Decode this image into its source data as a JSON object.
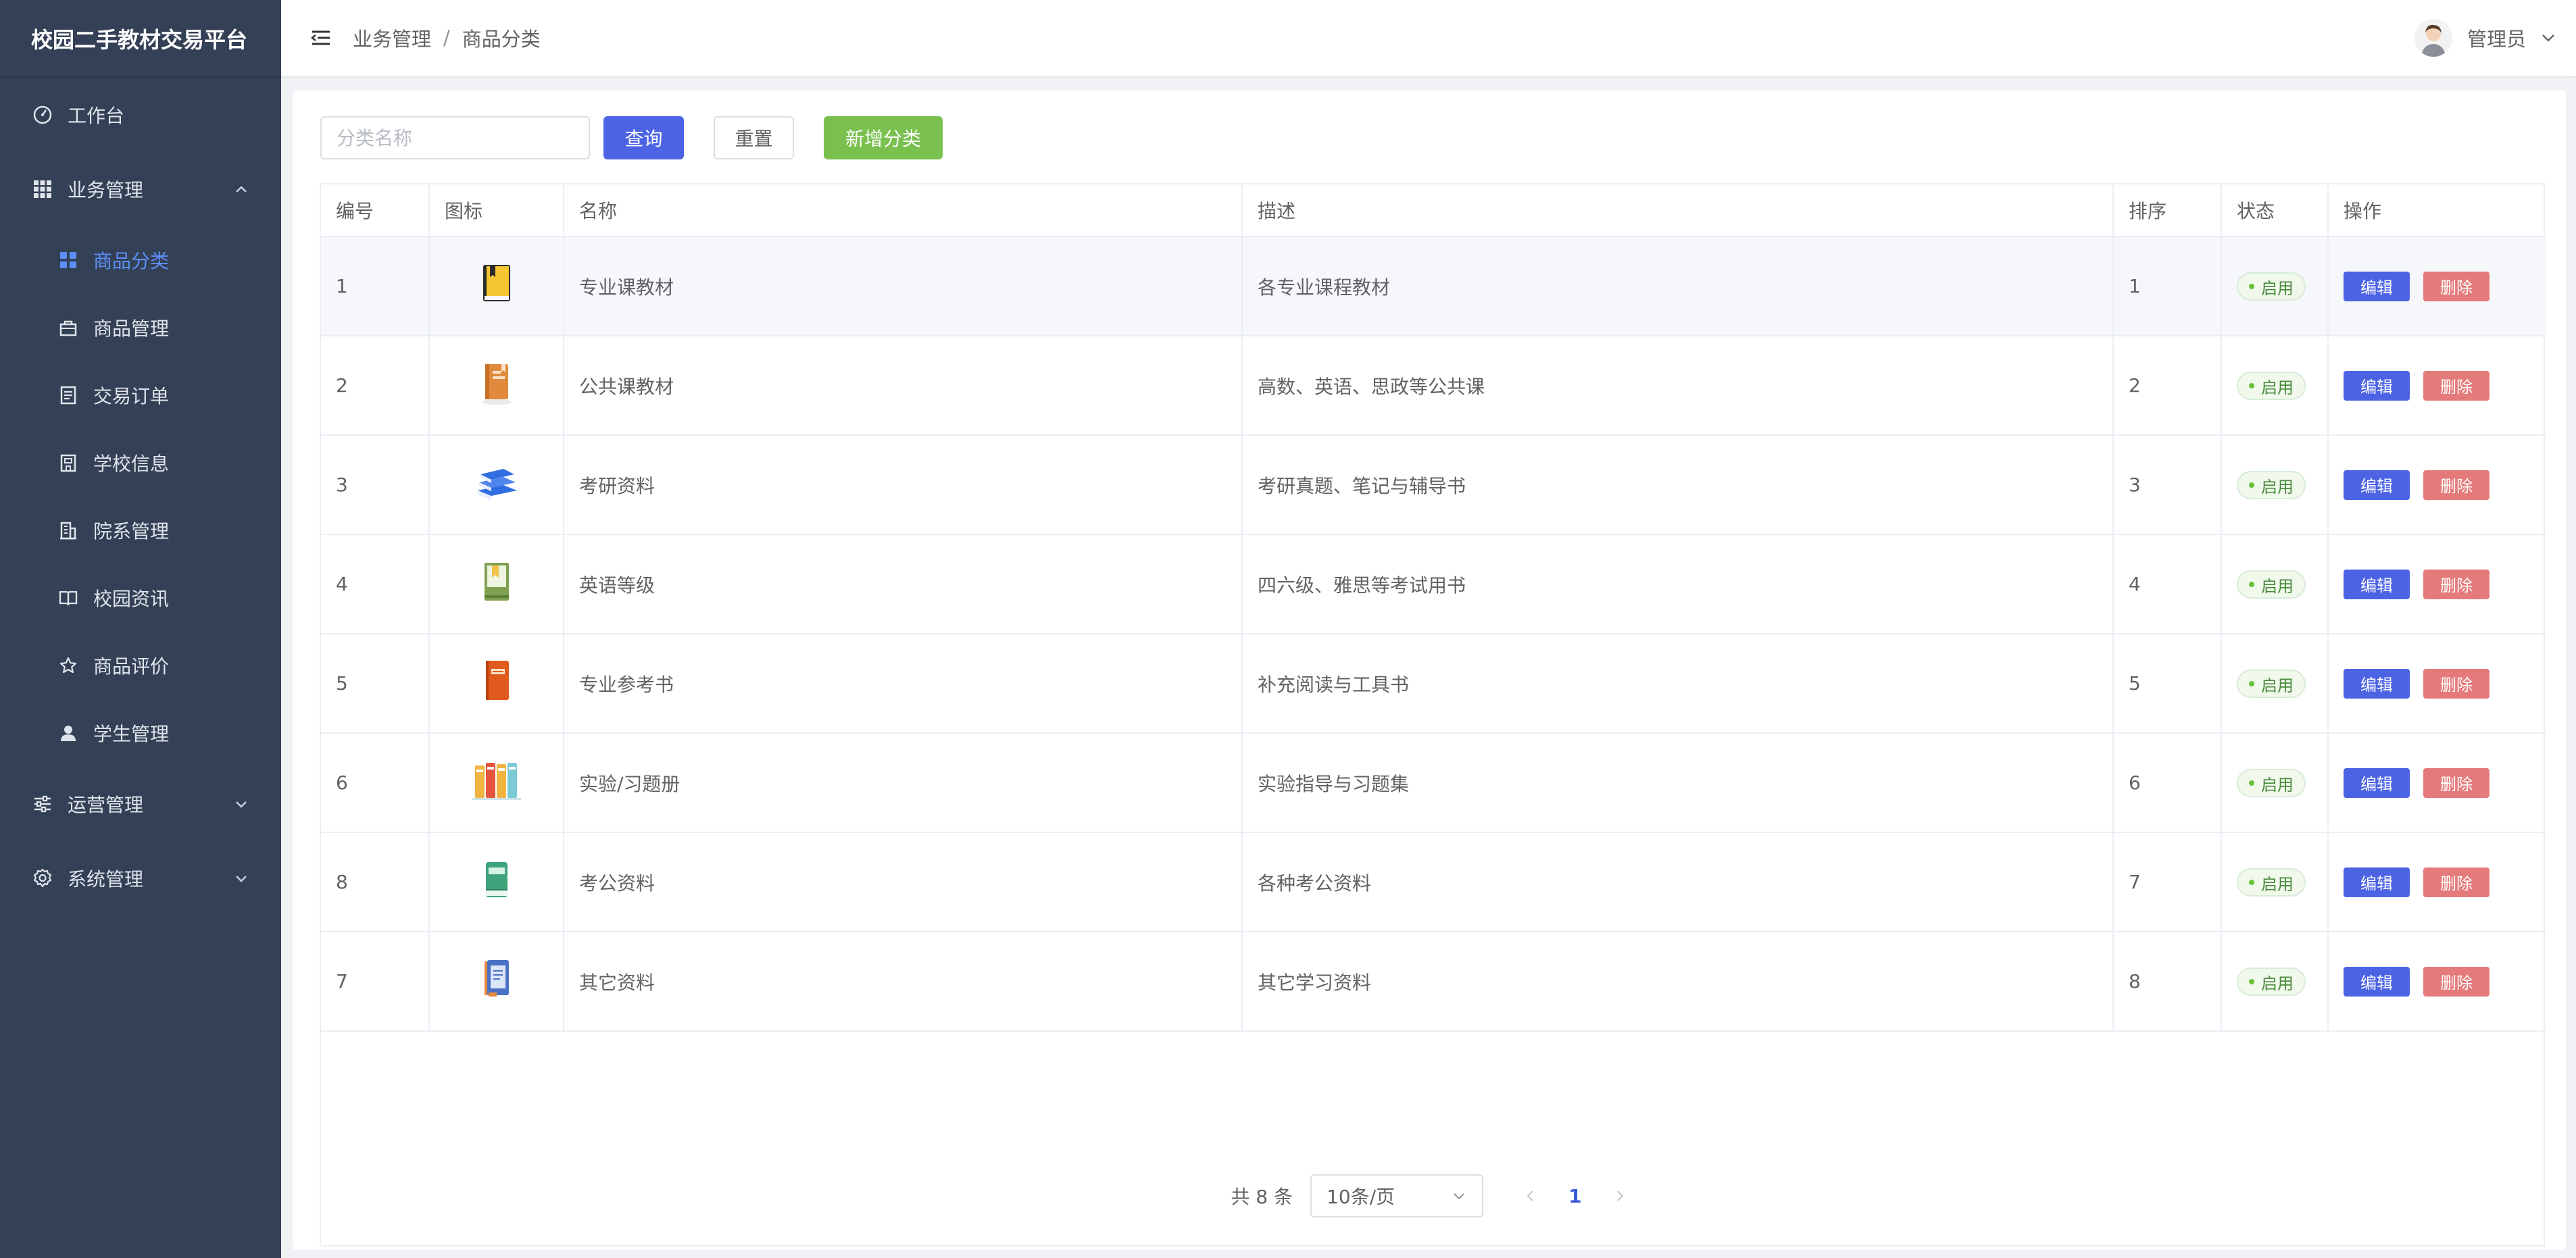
{
  "app": {
    "title": "校园二手教材交易平台"
  },
  "sidebar": {
    "items": [
      {
        "label": "工作台",
        "icon": "dashboard-icon"
      },
      {
        "label": "业务管理",
        "icon": "grid-icon",
        "expanded": true
      },
      {
        "label": "运营管理",
        "icon": "sliders-icon",
        "expanded": false
      },
      {
        "label": "系统管理",
        "icon": "gear-icon",
        "expanded": false
      }
    ],
    "business_sub": [
      {
        "label": "商品分类",
        "icon": "apps-icon",
        "active": true
      },
      {
        "label": "商品管理",
        "icon": "bag-icon"
      },
      {
        "label": "交易订单",
        "icon": "document-icon"
      },
      {
        "label": "学校信息",
        "icon": "school-icon"
      },
      {
        "label": "院系管理",
        "icon": "building-icon"
      },
      {
        "label": "校园资讯",
        "icon": "book-open-icon"
      },
      {
        "label": "商品评价",
        "icon": "star-icon"
      },
      {
        "label": "学生管理",
        "icon": "user-icon"
      }
    ]
  },
  "header": {
    "breadcrumb": [
      "业务管理",
      "商品分类"
    ],
    "separator": "/",
    "user_name": "管理员"
  },
  "toolbar": {
    "search_placeholder": "分类名称",
    "query_label": "查询",
    "reset_label": "重置",
    "add_label": "新增分类"
  },
  "table": {
    "columns": [
      "编号",
      "图标",
      "名称",
      "描述",
      "排序",
      "状态",
      "操作"
    ],
    "rows": [
      {
        "id": "1",
        "icon": "black-book-icon",
        "name": "专业课教材",
        "desc": "各专业课程教材",
        "sort": "1",
        "status": "启用"
      },
      {
        "id": "2",
        "icon": "orange-book-icon",
        "name": "公共课教材",
        "desc": "高数、英语、思政等公共课",
        "sort": "2",
        "status": "启用"
      },
      {
        "id": "3",
        "icon": "blue-books-stack-icon",
        "name": "考研资料",
        "desc": "考研真题、笔记与辅导书",
        "sort": "3",
        "status": "启用"
      },
      {
        "id": "4",
        "icon": "green-bookmark-book-icon",
        "name": "英语等级",
        "desc": "四六级、雅思等考试用书",
        "sort": "4",
        "status": "启用"
      },
      {
        "id": "5",
        "icon": "red-book-icon",
        "name": "专业参考书",
        "desc": "补充阅读与工具书",
        "sort": "5",
        "status": "启用"
      },
      {
        "id": "6",
        "icon": "binders-icon",
        "name": "实验/习题册",
        "desc": "实验指导与习题集",
        "sort": "6",
        "status": "启用"
      },
      {
        "id": "8",
        "icon": "teal-book-icon",
        "name": "考公资料",
        "desc": "各种考公资料",
        "sort": "7",
        "status": "启用"
      },
      {
        "id": "7",
        "icon": "blue-notebook-icon",
        "name": "其它资料",
        "desc": "其它学习资料",
        "sort": "8",
        "status": "启用"
      }
    ],
    "edit_label": "编辑",
    "delete_label": "删除"
  },
  "pagination": {
    "total_text": "共 8 条",
    "page_size": "10条/页",
    "current_page": "1"
  },
  "colors": {
    "sidebar_bg": "#344055",
    "primary": "#4c63e4",
    "success": "#7ac04e",
    "danger": "#e57a7a",
    "active_menu": "#5b8ff9"
  }
}
